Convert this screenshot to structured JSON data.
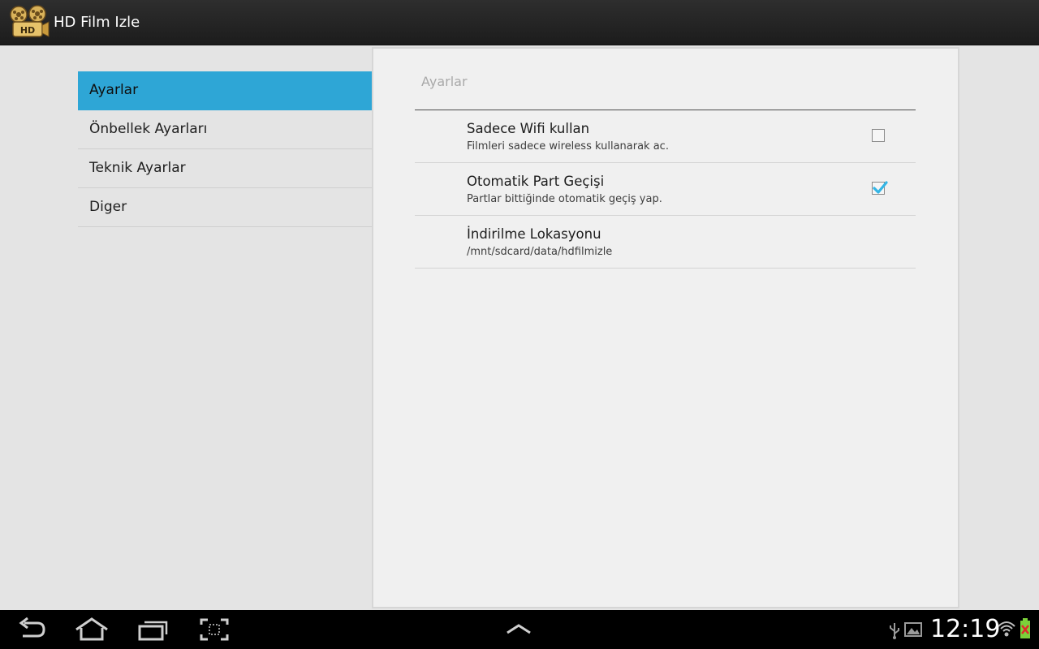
{
  "app": {
    "title": "HD Film Izle",
    "logo_icon": "hd-film-reel-icon"
  },
  "headers": [
    {
      "label": "Ayarlar",
      "active": true
    },
    {
      "label": "Önbellek Ayarları",
      "active": false
    },
    {
      "label": "Teknik Ayarlar",
      "active": false
    },
    {
      "label": "Diger",
      "active": false
    }
  ],
  "panel": {
    "title": "Ayarlar",
    "prefs": [
      {
        "title": "Sadece Wifi kullan",
        "summary": "Filmleri sadece wireless kullanarak ac.",
        "checked": false
      },
      {
        "title": "Otomatik Part Geçişi",
        "summary": "Partlar bittiğinde otomatik geçiş yap.",
        "checked": true
      },
      {
        "title": "İndirilme Lokasyonu",
        "summary": "/mnt/sdcard/data/hdfilmizle"
      }
    ]
  },
  "system_bar": {
    "time": "12:19",
    "buttons": [
      "back-icon",
      "home-icon",
      "recent-apps-icon",
      "screenshot-icon",
      "chevron-up-icon"
    ],
    "status_icons": [
      "usb-icon",
      "image-icon",
      "wifi-icon",
      "battery-icon"
    ]
  },
  "colors": {
    "accent": "#2ea6d6",
    "checkmark": "#33b5e5",
    "actionbar": "#222222"
  }
}
